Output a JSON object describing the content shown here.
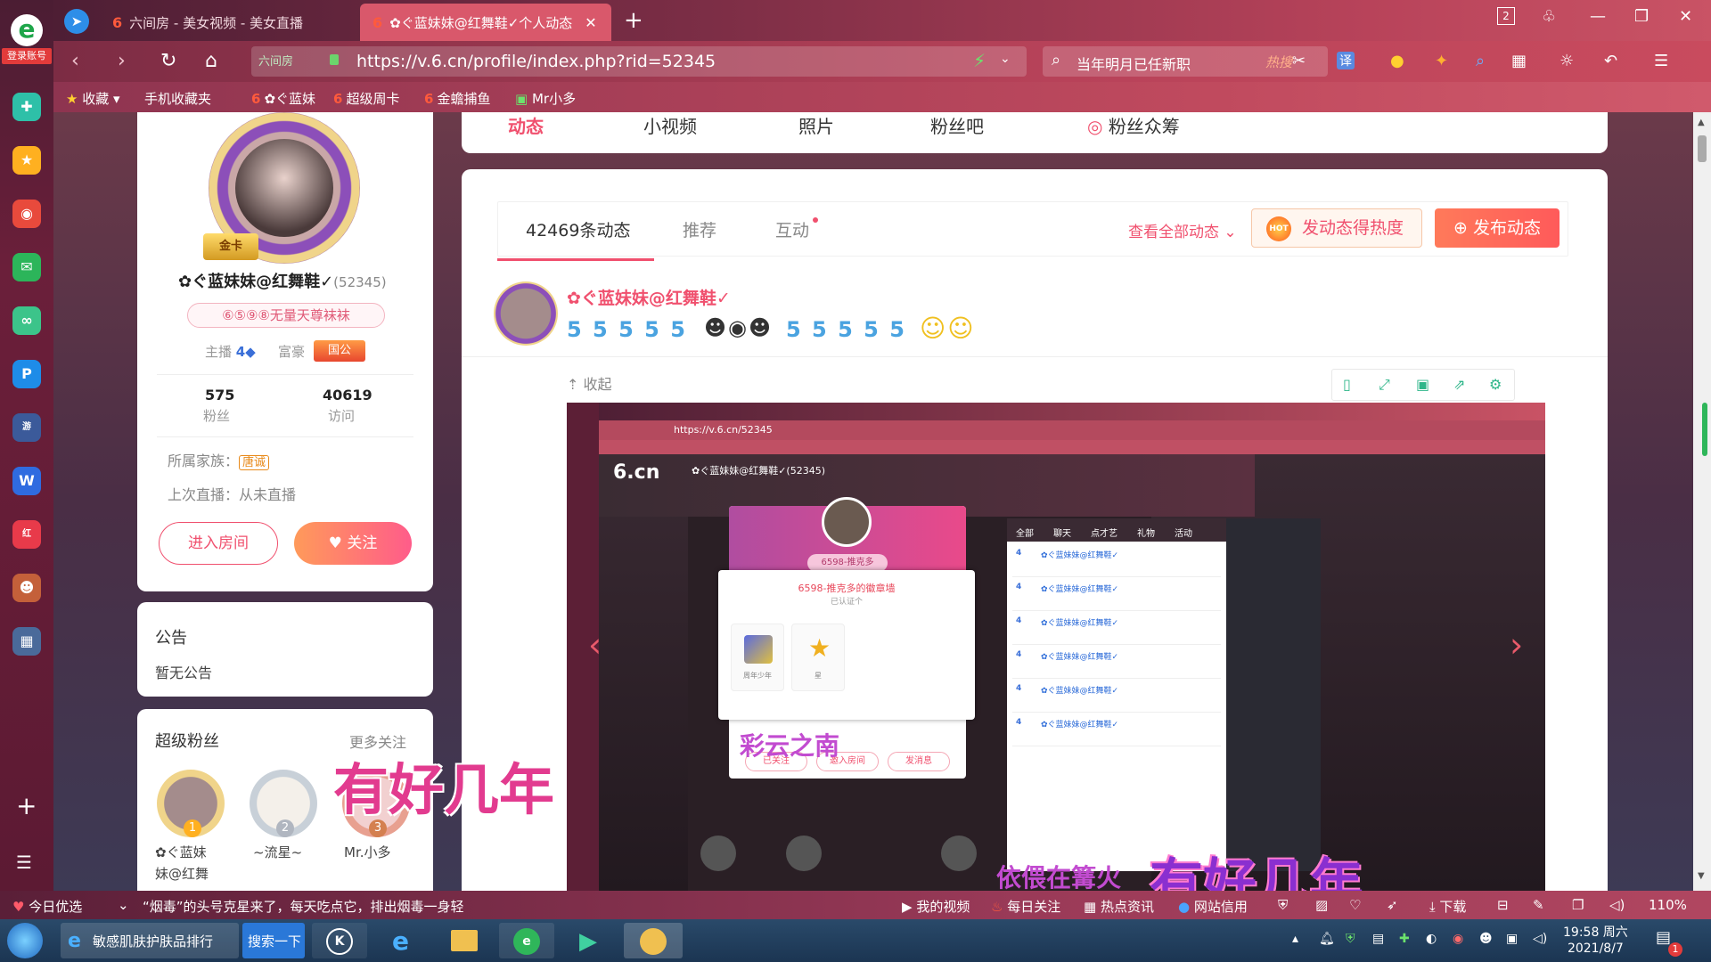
{
  "browser": {
    "tabs": [
      {
        "label": "六间房 - 美女视频 - 美女直播",
        "active": false
      },
      {
        "label": "✿ぐ蓝妹妹@红舞鞋✓个人动态",
        "active": true
      }
    ],
    "tab_count": "2",
    "login_label": "登录账号",
    "site_badge": "六间房",
    "url": "https://v.6.cn/profile/index.php?rid=52345",
    "search_text": "当年明月已任新职",
    "search_hot": "热搜",
    "bookmarks": [
      "收藏",
      "手机收藏夹",
      "✿ぐ蓝妹",
      "超级周卡",
      "金蟾捕鱼",
      "Mr小多"
    ]
  },
  "profile": {
    "name": "✿ぐ蓝妹妹@红舞鞋✓",
    "rid": "(52345)",
    "gold_card": "金卡",
    "title_pill": "⑥⑤⑨⑧无量天尊袜袜",
    "anchor_label": "主播",
    "anchor_level": "4",
    "rich_label": "富豪",
    "rich_badge": "国公",
    "fans_count": "575",
    "fans_label": "粉丝",
    "visits_count": "40619",
    "visits_label": "访问",
    "family_label": "所属家族：",
    "family_value": "唐诚",
    "last_live": "上次直播：从未直播",
    "enter_room": "进入房间",
    "follow": "关注"
  },
  "announcement": {
    "title": "公告",
    "body": "暂无公告"
  },
  "super_fans": {
    "title": "超级粉丝",
    "more": "更多关注",
    "fans": [
      {
        "rank": "1",
        "name": "✿ぐ蓝妹",
        "name2": "妹@红舞"
      },
      {
        "rank": "2",
        "name": "~流星~",
        "name2": ""
      },
      {
        "rank": "3",
        "name": "Mr.小多",
        "name2": ""
      }
    ]
  },
  "top_nav": [
    "动态",
    "小视频",
    "照片",
    "粉丝吧",
    "粉丝众筹"
  ],
  "feed": {
    "tabs": [
      "42469条动态",
      "推荐",
      "互动"
    ],
    "view_all": "查看全部动态",
    "hot_button": "发动态得热度",
    "hot_icon_text": "HOT",
    "publish_button": "发布动态",
    "post_author": "✿ぐ蓝妹妹@红舞鞋✓",
    "post_emotes_left": "5 5 5 5 5",
    "post_emotes_right": "5 5 5 5 5",
    "collapse": "收起"
  },
  "embedded": {
    "url": "https://v.6.cn/52345",
    "logo": "6.cn",
    "room_name": "✿ぐ蓝妹妹@红舞鞋✓(52345)",
    "popup_id": "6598-推克多",
    "badge_title": "6598-推克多的徽章墙",
    "badge_sub": "已认证个",
    "badge_tile_1": "周年少年",
    "badge_tile_2": "星",
    "popup_buttons": [
      "已关注",
      "邀入房间",
      "发消息"
    ],
    "chat_tabs": [
      "全部",
      "聊天",
      "点才艺",
      "礼物",
      "活动"
    ],
    "chat_level": "4",
    "chat_names": [
      "✿ぐ蓝妹妹@红舞鞋✓",
      "✿ぐ蓝妹妹@红舞鞋✓",
      "✿ぐ蓝妹妹@红舞鞋✓",
      "✿ぐ蓝妹妹@红舞鞋✓",
      "✿ぐ蓝妹妹@红舞鞋✓",
      "✿ぐ蓝妹妹@红舞鞋✓"
    ],
    "caption": "彩云之南"
  },
  "overlay_captions": {
    "left": "有好几年",
    "right": "有好几年",
    "right_small": "依偎在篝火"
  },
  "newsbar": {
    "today": "今日优选",
    "headline": "“烟毒”的头号克星来了，每天吃点它，排出烟毒一身轻",
    "items": [
      "我的视频",
      "每日关注",
      "热点资讯",
      "网站信用",
      "下载"
    ],
    "zoom": "110%"
  },
  "taskbar": {
    "ie_item": "敏感肌肤护肤品排行",
    "search_button": "搜索一下",
    "time": "19:58 周六",
    "date": "2021/8/7",
    "notify_count": "1"
  }
}
